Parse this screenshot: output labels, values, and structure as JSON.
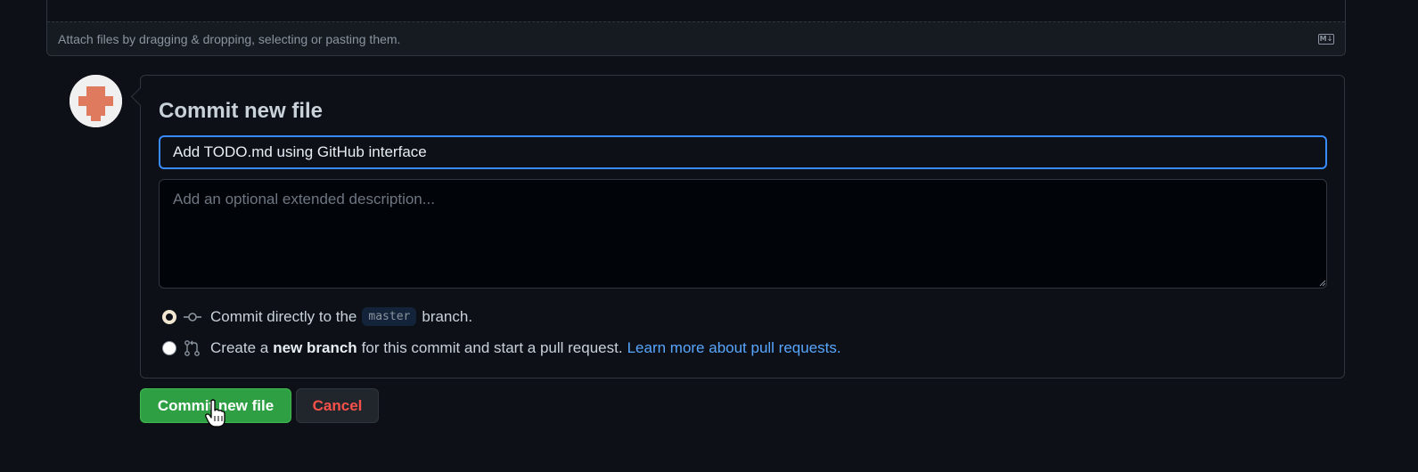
{
  "editor": {
    "attach_text": "Attach files by dragging & dropping, selecting or pasting them.",
    "markdown_icon": "markdown-icon"
  },
  "commit": {
    "title": "Commit new file",
    "summary_value": "Add TODO.md using GitHub interface",
    "description_placeholder": "Add an optional extended description...",
    "options": {
      "direct": {
        "text_before": "Commit directly to the",
        "branch": "master",
        "text_after": "branch.",
        "icon": "git-commit-icon",
        "selected": true
      },
      "new_branch": {
        "text_before": "Create a",
        "bold": "new branch",
        "text_after": "for this commit and start a pull request.",
        "link": "Learn more about pull requests.",
        "icon": "git-pull-request-icon",
        "selected": false
      }
    }
  },
  "buttons": {
    "commit_label": "Commit new file",
    "cancel_label": "Cancel"
  },
  "colors": {
    "background": "#0d1117",
    "accent_blue": "#388bfd",
    "link": "#58a6ff",
    "commit_green": "#2ea043",
    "cancel_red": "#f85149"
  }
}
